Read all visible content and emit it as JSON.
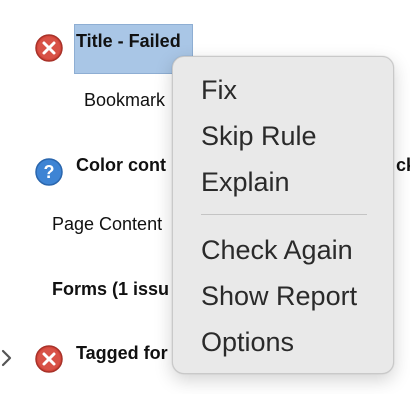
{
  "tree": {
    "title_item": {
      "label": "Title - Failed",
      "icon": "failed-icon"
    },
    "bookmarks_item": {
      "label": "Bookmark"
    },
    "color_item": {
      "label": "Color cont",
      "label_tail": "ck",
      "icon": "question-icon"
    },
    "page_content_item": {
      "label": "Page Content"
    },
    "forms_item": {
      "label": "Forms (1 issu"
    },
    "tagged_item": {
      "label": "Tagged for",
      "icon": "failed-icon",
      "expander": "chevron-right-icon"
    }
  },
  "context_menu": {
    "items": [
      {
        "label": "Fix"
      },
      {
        "label": "Skip Rule"
      },
      {
        "label": "Explain"
      },
      {
        "label": "Check Again"
      },
      {
        "label": "Show Report"
      },
      {
        "label": "Options"
      }
    ]
  },
  "colors": {
    "failed": "#d4463b",
    "question": "#3e84d4",
    "selection": "#a9c6e6",
    "menu_bg": "#e9e9e9"
  }
}
